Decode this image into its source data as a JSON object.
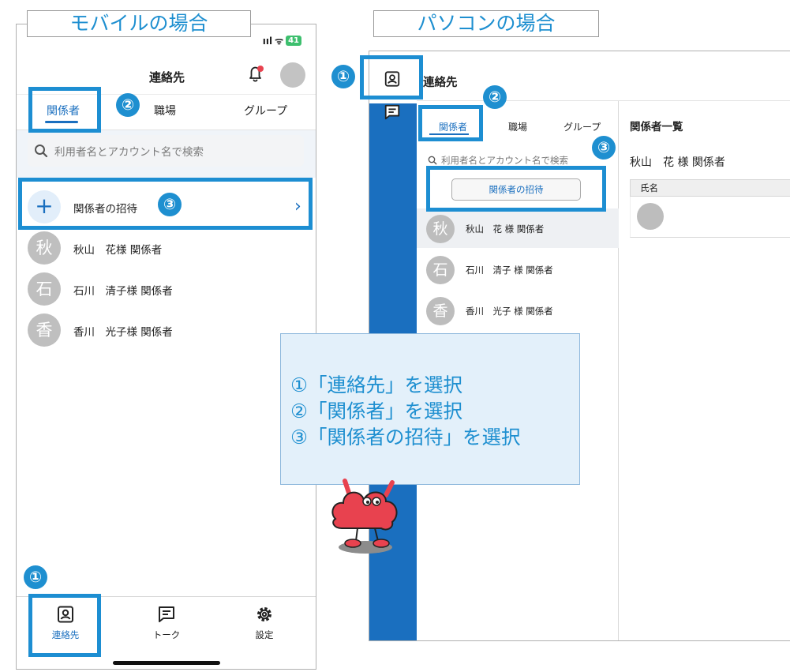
{
  "mobile": {
    "section_title": "モバイルの場合",
    "status": {
      "signal": "ııl",
      "wifi": "ᯤ",
      "battery": "41"
    },
    "header": {
      "title": "連絡先"
    },
    "tabs": [
      {
        "label": "関係者"
      },
      {
        "label": "職場"
      },
      {
        "label": "グループ"
      }
    ],
    "search": {
      "placeholder": "利用者名とアカウント名で検索"
    },
    "invite": {
      "label": "関係者の招待"
    },
    "contacts": [
      {
        "initial": "秋",
        "name": "秋山　花様 関係者"
      },
      {
        "initial": "石",
        "name": "石川　清子様 関係者"
      },
      {
        "initial": "香",
        "name": "香川　光子様 関係者"
      }
    ],
    "bottom_nav": [
      {
        "label": "連絡先"
      },
      {
        "label": "トーク"
      },
      {
        "label": "設定"
      }
    ]
  },
  "pc": {
    "section_title": "パソコンの場合",
    "header": {
      "title": "連絡先"
    },
    "tabs": [
      {
        "label": "関係者"
      },
      {
        "label": "職場"
      },
      {
        "label": "グループ"
      }
    ],
    "search": {
      "placeholder": "利用者名とアカウント名で検索"
    },
    "invite": {
      "label": "関係者の招待"
    },
    "contacts": [
      {
        "initial": "秋",
        "name": "秋山　花 様 関係者"
      },
      {
        "initial": "石",
        "name": "石川　清子 様 関係者"
      },
      {
        "initial": "香",
        "name": "香川　光子 様 関係者"
      }
    ],
    "detail": {
      "title": "関係者一覧",
      "selected_name": "秋山　花 様 関係者",
      "column_header": "氏名"
    }
  },
  "steps": {
    "markers": {
      "one": "①",
      "two": "②",
      "three": "③"
    },
    "instructions": [
      "①「連絡先」を選択",
      "②「関係者」を選択",
      "③「関係者の招待」を選択"
    ]
  },
  "colors": {
    "accent": "#1e8fd0",
    "app_blue": "#1a6fbf",
    "mascot_red": "#e8424f"
  }
}
